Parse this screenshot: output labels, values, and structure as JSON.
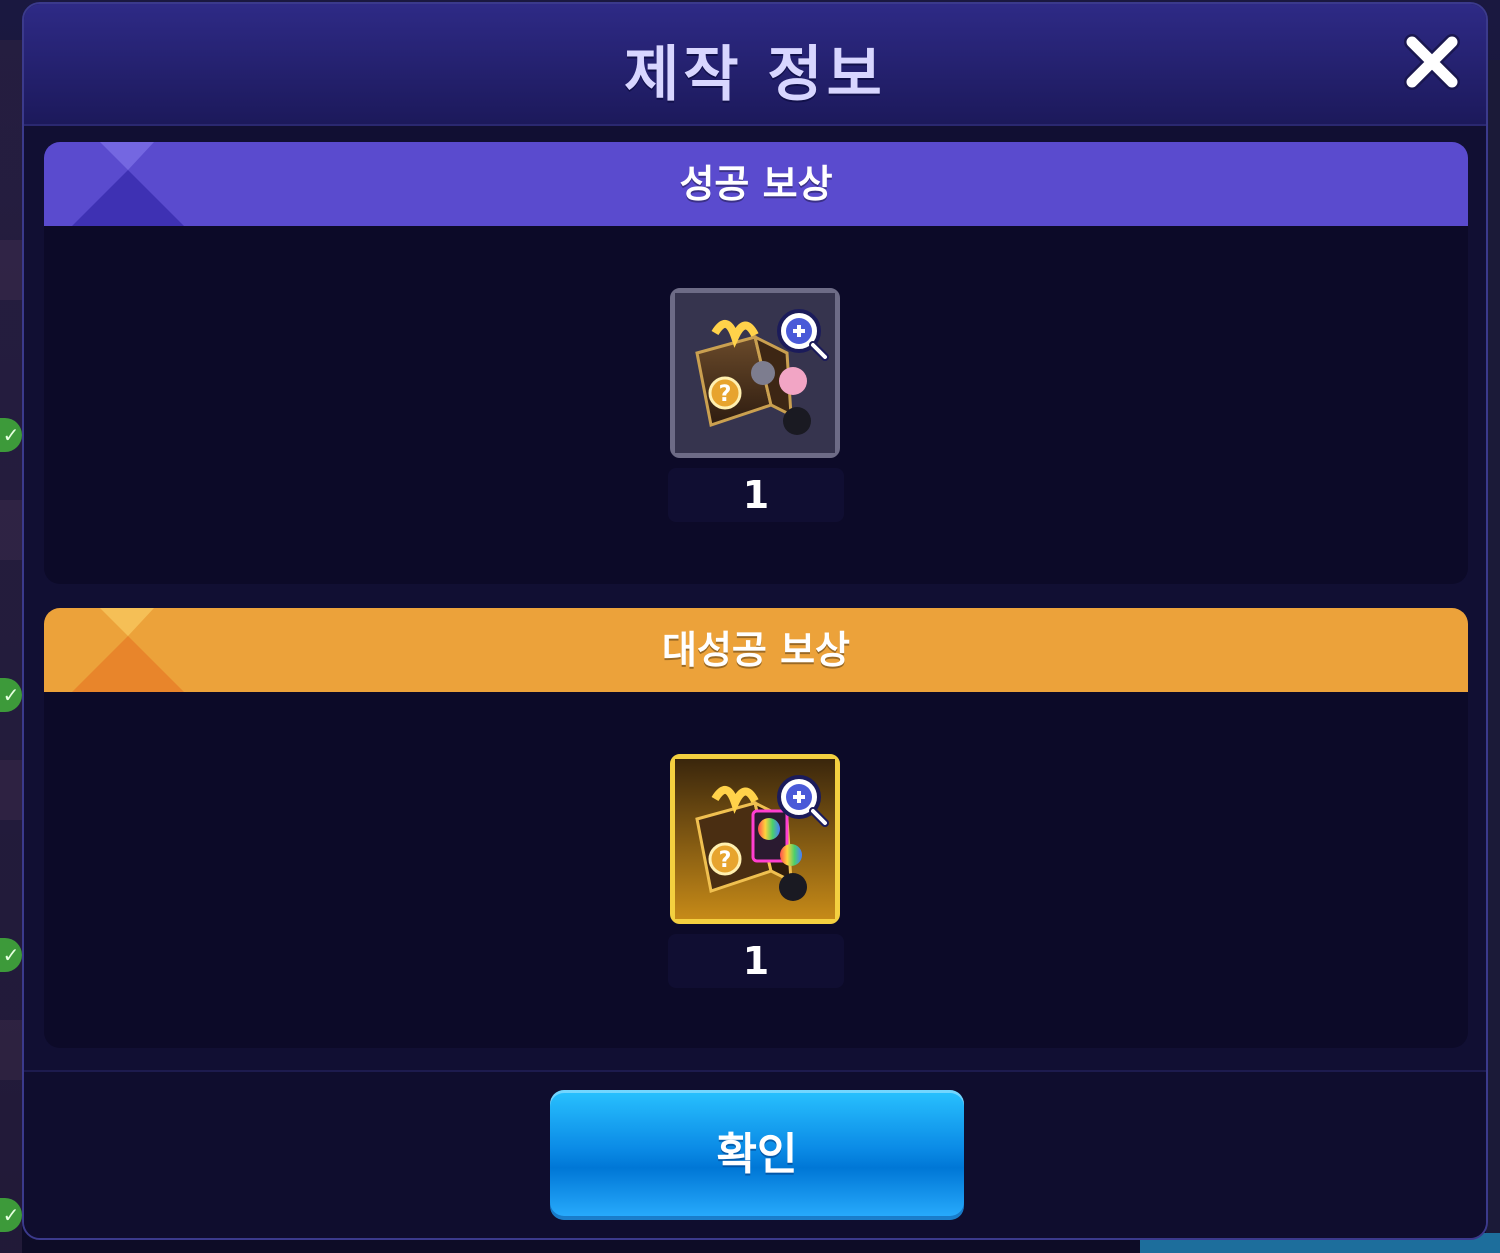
{
  "dialog": {
    "title": "제작 정보",
    "close_icon": "close-icon"
  },
  "sections": [
    {
      "label": "성공 보상",
      "header_color": "#5a4bce",
      "item": {
        "icon": "random-box-icon",
        "count": "1"
      }
    },
    {
      "label": "대성공 보상",
      "header_color": "#eca23a",
      "item": {
        "icon": "premium-random-box-icon",
        "count": "1"
      }
    }
  ],
  "footer": {
    "confirm_label": "확인",
    "confirm_color": "#0b8be6"
  }
}
